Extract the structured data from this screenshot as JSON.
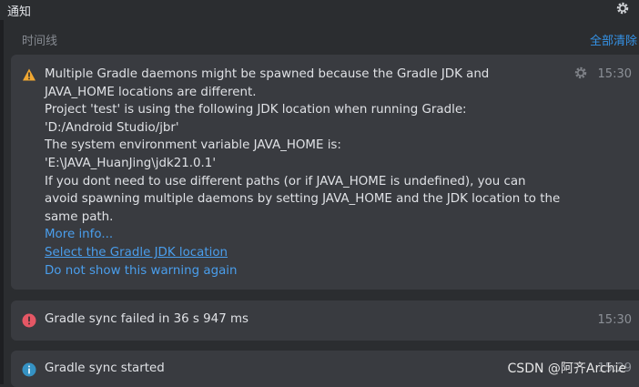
{
  "window": {
    "title": "通知"
  },
  "toolbar": {
    "timeline_label": "时间线",
    "clear_all_label": "全部清除"
  },
  "notifications": [
    {
      "type": "warning",
      "time": "15:30",
      "lines": [
        "Multiple Gradle daemons might be spawned because the Gradle JDK and",
        "JAVA_HOME locations are different.",
        "Project 'test' is using the following JDK location when running Gradle:",
        "'D:/Android Studio/jbr'",
        "The system environment variable JAVA_HOME is:",
        "'E:\\JAVA_HuanJing\\jdk21.0.1'",
        "If you dont need to use different paths (or if JAVA_HOME is undefined), you can",
        "avoid spawning multiple daemons by setting JAVA_HOME and the JDK location to the",
        "same path."
      ],
      "links": [
        "More info...",
        "Select the Gradle JDK location",
        "Do not show this warning again"
      ]
    },
    {
      "type": "error",
      "time": "15:30",
      "text": "Gradle sync failed in 36 s 947 ms"
    },
    {
      "type": "info",
      "time": "15:29",
      "text": "Gradle sync started"
    }
  ],
  "watermark": "CSDN @阿齐Archie",
  "colors": {
    "background": "#2b2d30",
    "card": "#393b40",
    "link": "#4a9eec",
    "warning": "#f0a732",
    "error": "#e55765",
    "info": "#3592c4"
  },
  "icons": {
    "settings": "gear-icon",
    "warning": "warning-icon",
    "error": "error-icon",
    "info": "info-icon"
  }
}
